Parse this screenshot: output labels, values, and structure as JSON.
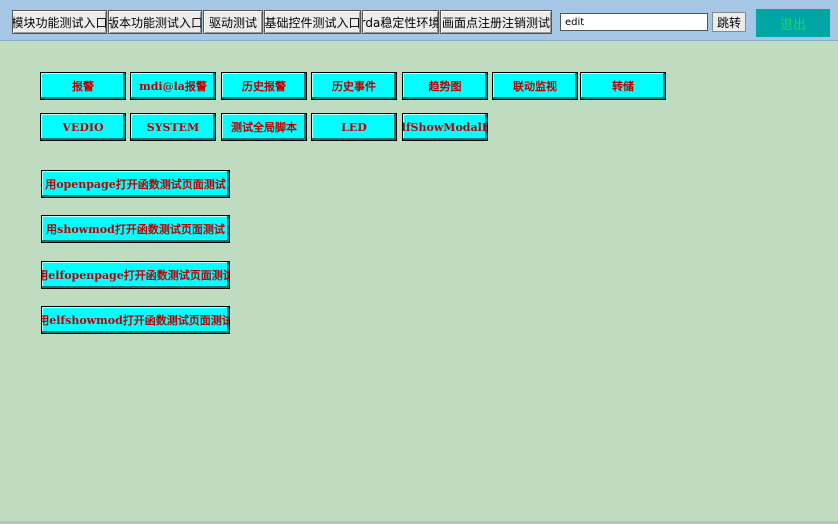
{
  "toolbar": {
    "tabs": [
      "模块功能测试入口",
      "版本功能测试入口",
      "驱动测试",
      "基础控件测试入口",
      "rda稳定性环境",
      "画面点注册注销测试"
    ],
    "edit_value": "edit",
    "jump_label": "跳转",
    "exit_label": "退出"
  },
  "main": {
    "row1": [
      "报警",
      "mdi@la报警",
      "历史报警",
      "历史事件",
      "趋势图",
      "联动监视",
      "转储"
    ],
    "row2": [
      "VEDIO",
      "SYSTEM",
      "测试全局脚本",
      "LED",
      "ElfShowModalEx"
    ],
    "open_buttons": [
      "用openpage打开函数测试页面测试",
      "用showmod打开函数测试页面测试",
      "用elfopenpage打开函数测试页面测试",
      "用elfshowmod打开函数测试页面测试"
    ]
  },
  "colors": {
    "button_bg": "#00ffff",
    "button_text": "#c00000",
    "background": "#c0dcc0",
    "topbar": "#a6c6e6"
  }
}
